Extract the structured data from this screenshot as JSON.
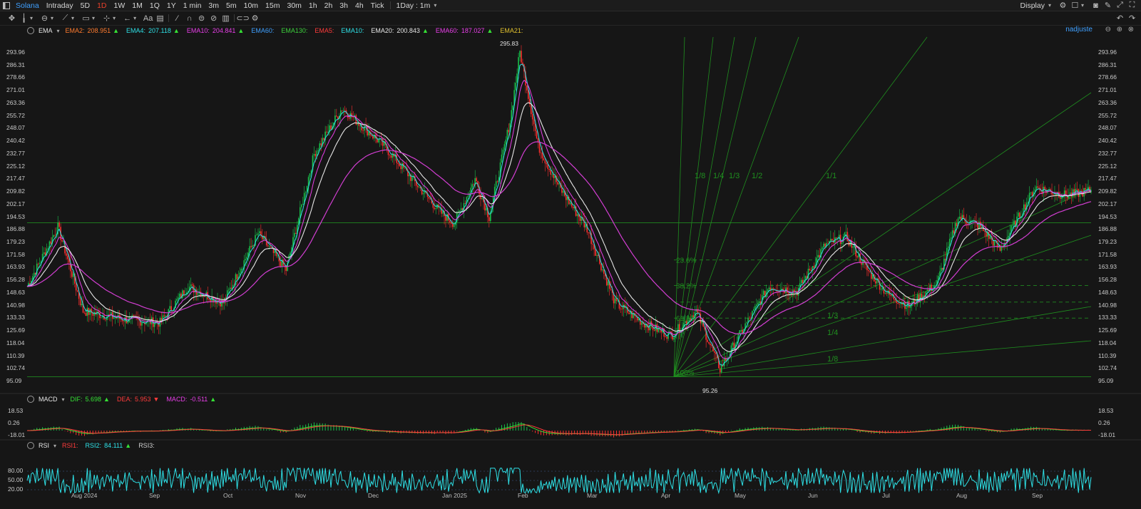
{
  "topbar": {
    "symbol": "Solana",
    "periods": [
      "Intraday",
      "5D",
      "1D",
      "1W",
      "1M",
      "1Q",
      "1Y",
      "1 min",
      "3m",
      "5m",
      "10m",
      "15m",
      "30m",
      "1h",
      "2h",
      "3h",
      "4h",
      "Tick"
    ],
    "active_period": "1D",
    "interval_select": "1Day : 1m",
    "display_label": "Display",
    "unadjusted_label": "nadjuste"
  },
  "icons": {
    "left_tools": [
      "move-icon",
      "cursor-icon",
      "crosshair-icon",
      "line-tool-icon",
      "rectangle-icon",
      "measure-icon",
      "undo-arrow-icon",
      "text-icon",
      "note-icon",
      "pencil-icon",
      "magnet-icon",
      "lock-icon",
      "hide-icon",
      "trash-icon",
      "link-icon",
      "settings-icon"
    ],
    "right_tools": [
      "settings-icon",
      "window-icon",
      "camera-icon",
      "draw-icon",
      "fullscreen-icon",
      "expand-icon"
    ]
  },
  "main_legend": {
    "name": "EMA",
    "items": [
      {
        "label": "EMA2:",
        "value": "208.951",
        "color": "#ff7b2e",
        "trend": "up"
      },
      {
        "label": "EMA4:",
        "value": "207.118",
        "color": "#2ee0e6",
        "trend": "up"
      },
      {
        "label": "EMA10:",
        "value": "204.841",
        "color": "#e83ee8",
        "trend": "up"
      },
      {
        "label": "EMA60:",
        "value": "",
        "color": "#3fa0ff",
        "trend": ""
      },
      {
        "label": "EMA130:",
        "value": "",
        "color": "#3ccf3c",
        "trend": ""
      },
      {
        "label": "EMA5:",
        "value": "",
        "color": "#ff3b3b",
        "trend": ""
      },
      {
        "label": "EMA10:",
        "value": "",
        "color": "#2ee0e6",
        "trend": ""
      },
      {
        "label": "EMA20:",
        "value": "200.843",
        "color": "#e6e6e6",
        "trend": "up"
      },
      {
        "label": "EMA60:",
        "value": "187.027",
        "color": "#e83ee8",
        "trend": "up"
      },
      {
        "label": "EMA21:",
        "value": "",
        "color": "#e0c02e",
        "trend": ""
      }
    ]
  },
  "price_axis": [
    "293.96",
    "286.31",
    "278.66",
    "271.01",
    "263.36",
    "255.72",
    "248.07",
    "240.42",
    "232.77",
    "225.12",
    "217.47",
    "209.82",
    "202.17",
    "194.53",
    "186.88",
    "179.23",
    "171.58",
    "163.93",
    "156.28",
    "148.63",
    "140.98",
    "133.33",
    "125.69",
    "118.04",
    "110.39",
    "102.74",
    "95.09"
  ],
  "price_axis_right": [
    "293.96",
    "286.31",
    "278.66",
    "271.01",
    "263.36",
    "255.72",
    "248.07",
    "240.42",
    "232.77",
    "225.12",
    "217.47",
    "209.82",
    "202.17",
    "194.53",
    "186.88",
    "179.23",
    "171.58",
    "163.93",
    "156.28",
    "148.63",
    "140.98",
    "133.33",
    "125.69",
    "118.04",
    "110.39",
    "102.74",
    "95.09"
  ],
  "annotations": {
    "high_label": "295.83",
    "low_label": "95.26",
    "fan_labels_top": [
      "1/8",
      "1/4",
      "1/3",
      "1/2",
      "1/1"
    ],
    "fan_labels_bottom": [
      "1/3",
      "1/4",
      "1/8"
    ],
    "fib_labels": [
      "23.6%",
      "38.2%",
      "61.8%",
      "100%"
    ]
  },
  "macd_legend": {
    "name": "MACD",
    "items": [
      {
        "label": "DIF:",
        "value": "5.698",
        "color": "#35e035",
        "trend": "up"
      },
      {
        "label": "DEA:",
        "value": "5.953",
        "color": "#ff3b3b",
        "trend": "down"
      },
      {
        "label": "MACD:",
        "value": "-0.511",
        "color": "#e83ee8",
        "trend": "up"
      }
    ],
    "axis": [
      "18.53",
      "0.26",
      "-18.01"
    ]
  },
  "rsi_legend": {
    "name": "RSI",
    "items": [
      {
        "label": "RSI1:",
        "value": "",
        "color": "#ff3b3b",
        "trend": ""
      },
      {
        "label": "RSI2:",
        "value": "84.111",
        "color": "#2ee0e6",
        "trend": "up"
      },
      {
        "label": "RSI3:",
        "value": "",
        "color": "#cfcfcf",
        "trend": ""
      }
    ],
    "axis": [
      "80.00",
      "50.00",
      "20.00"
    ]
  },
  "x_axis": [
    "Aug 2024",
    "Sep",
    "Oct",
    "Nov",
    "Dec",
    "Jan 2025",
    "Feb",
    "Mar",
    "Apr",
    "May",
    "Jun",
    "Jul",
    "Aug",
    "Sep"
  ],
  "colors": {
    "up": "#19c24a",
    "down": "#ff2e2e",
    "grid": "#262626",
    "fan": "#1f8f1f"
  }
}
